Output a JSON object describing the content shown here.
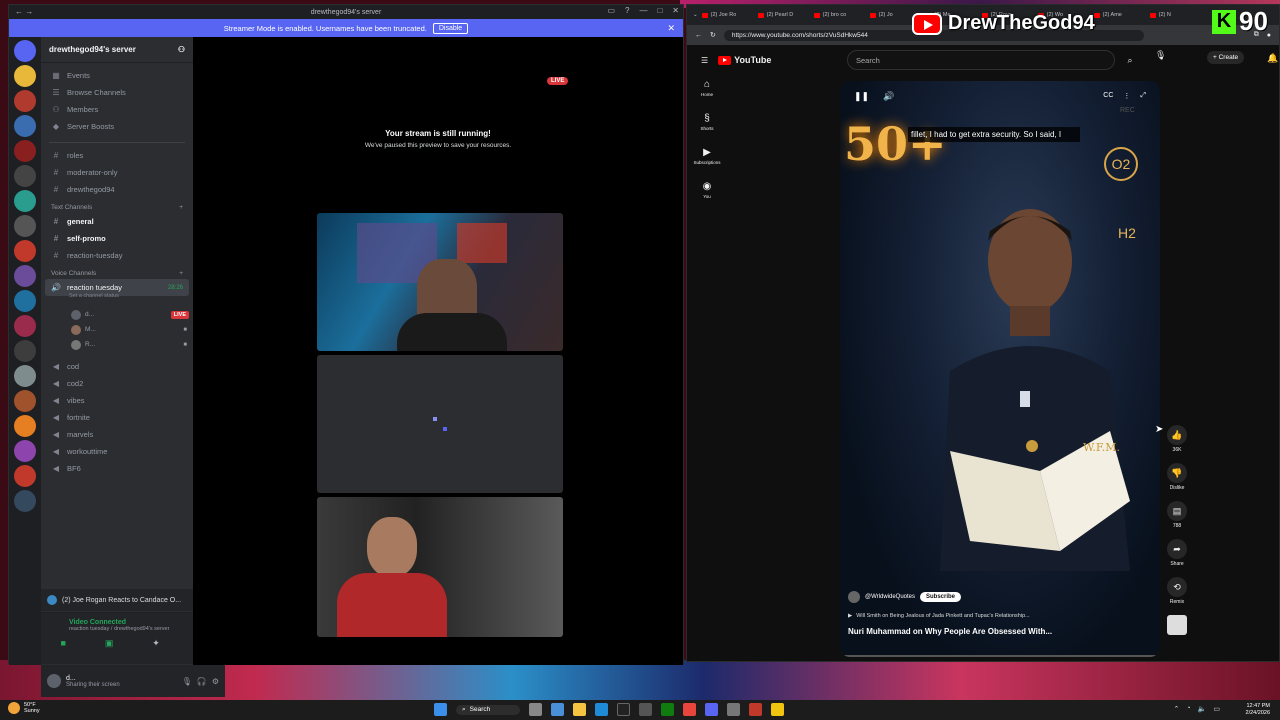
{
  "discord": {
    "window_title": "drewthegod94's server",
    "banner": {
      "text": "Streamer Mode is enabled. Usernames have been truncated.",
      "button": "Disable"
    },
    "server_name": "drewthegod94's server",
    "top_items": [
      {
        "icon": "calendar-icon",
        "label": "Events"
      },
      {
        "icon": "browse-icon",
        "label": "Browse Channels"
      },
      {
        "icon": "members-icon",
        "label": "Members"
      },
      {
        "icon": "boost-icon",
        "label": "Server Boosts"
      }
    ],
    "text_channels_top": [
      "roles",
      "moderator-only",
      "drewthegod94"
    ],
    "text_category": "Text Channels",
    "text_channels": [
      {
        "name": "general",
        "bold": true
      },
      {
        "name": "self-promo",
        "bold": true
      },
      {
        "name": "reaction-tuesday",
        "bold": false
      }
    ],
    "voice_category": "Voice Channels",
    "active_voice": {
      "name": "reaction tuesday",
      "status": "Set a channel status",
      "time": "28:26"
    },
    "voice_users": [
      {
        "name": "d...",
        "live": "LIVE"
      },
      {
        "name": "M...",
        "live": ""
      },
      {
        "name": "R...",
        "live": ""
      }
    ],
    "voice_channels": [
      "cod",
      "cod2",
      "vibes",
      "fortnite",
      "marvels",
      "workouttime",
      "BF6"
    ],
    "pinned": "(2) Joe Rogan Reacts to Candace O...",
    "vc_status": "Video Connected",
    "vc_location": "reaction tuesday / drewthegod94's server",
    "user": {
      "name": "d...",
      "status": "Sharing their screen"
    },
    "stage": {
      "live": "LIVE",
      "paused_title": "Your stream is still running!",
      "paused_sub": "We've paused this preview to save your resources."
    }
  },
  "browser": {
    "tabs": [
      "(2) Joe Ro",
      "(2) Pearl D",
      "(2) bro co",
      "(2) Jo",
      "(2) Me",
      "(2) Royo",
      "(2) Wo",
      "(2) Ame",
      "(2) N"
    ],
    "url": "https://www.youtube.com/shorts/zVuSdHkw544"
  },
  "youtube": {
    "logo": "YouTube",
    "search_placeholder": "Search",
    "create": "Create",
    "rail": [
      "Home",
      "Shorts",
      "Subscriptions",
      "You"
    ],
    "caption": "fillet, I had to get extra security. So I said, I",
    "overlay_text": "50+",
    "o2": "O2",
    "h2": "H2",
    "badge": "W.F.M.",
    "rec": "REC",
    "channel": "@WrldwideQuotes",
    "subscribe": "Subscribe",
    "related": "Will Smith on Being Jealous of Jada Pinkett and Tupac's Relationship...",
    "title": "Nuri Muhammad on Why People Are Obsessed With...",
    "actions": [
      {
        "icon": "like-icon",
        "label": "36K"
      },
      {
        "icon": "dislike-icon",
        "label": "Dislike"
      },
      {
        "icon": "comments-icon",
        "label": "788"
      },
      {
        "icon": "share-icon",
        "label": "Share"
      },
      {
        "icon": "remix-icon",
        "label": "Remix"
      }
    ]
  },
  "overlay": {
    "channel": "DrewTheGod94",
    "kick_count": "90"
  },
  "taskbar": {
    "temp": "50°F",
    "weather": "Sunny",
    "search": "Search",
    "time": "12:47 PM",
    "date": "2/24/2026"
  },
  "colors": {
    "discord_blurple": "#5865f2",
    "live_red": "#da373c",
    "youtube_red": "#ff0000",
    "kick_green": "#53fc18"
  }
}
